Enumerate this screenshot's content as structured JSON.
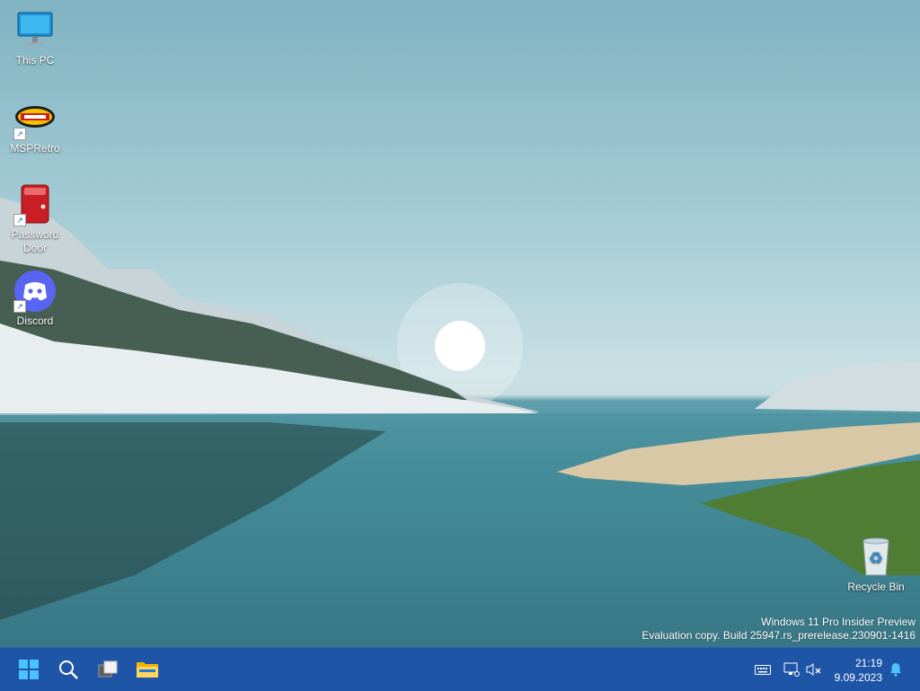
{
  "desktop_icons": [
    {
      "label": "This PC",
      "icon": "this-pc-icon"
    },
    {
      "label": "MSPRetro",
      "icon": "msp-retro-icon"
    },
    {
      "label": "Password\nDoor",
      "icon": "password-door-icon"
    },
    {
      "label": "Discord",
      "icon": "discord-icon"
    },
    {
      "label": "Recycle Bin",
      "icon": "recycle-bin-icon"
    }
  ],
  "watermark": {
    "line1": "Windows 11 Pro Insider Preview",
    "line2": "Evaluation copy. Build 25947.rs_prerelease.230901-1416"
  },
  "taskbar": {
    "buttons": [
      "start-icon",
      "search-icon",
      "task-view-icon",
      "file-explorer-icon"
    ],
    "tray": [
      "keyboard-icon",
      "network-icon",
      "volume-muted-icon",
      "notification-bell-icon"
    ],
    "time": "21:19",
    "date": "9.09.2023",
    "accent": "#1f55a6"
  }
}
